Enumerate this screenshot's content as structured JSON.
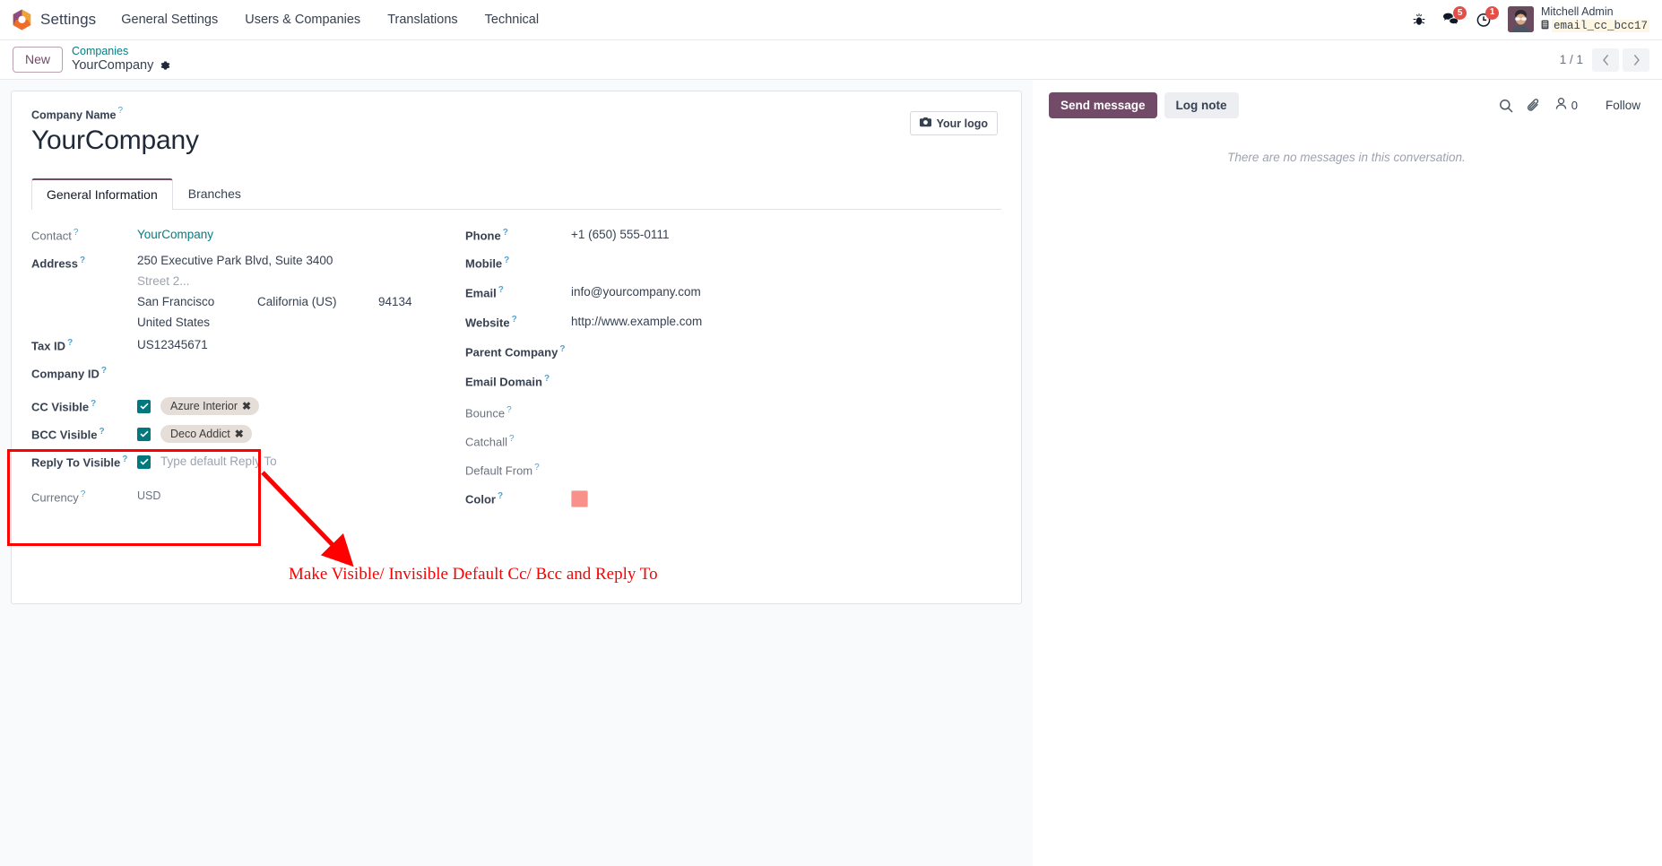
{
  "navbar": {
    "app_name": "Settings",
    "logo_icon": "odoo-hexagon-logo",
    "menu_items": [
      {
        "label": "General Settings"
      },
      {
        "label": "Users & Companies"
      },
      {
        "label": "Translations"
      },
      {
        "label": "Technical"
      }
    ],
    "icons": {
      "bug": "bug-icon",
      "messages": "messages-icon",
      "messages_badge": "5",
      "activities": "clock-activities-icon",
      "activities_badge": "1"
    },
    "user": {
      "name": "Mitchell Admin",
      "database": "email_cc_bcc17",
      "db_icon": "database-icon",
      "avatar": "user-avatar"
    }
  },
  "controlpanel": {
    "new_label": "New",
    "breadcrumb_parent": "Companies",
    "breadcrumb_current": "YourCompany",
    "gear_icon": "gear-icon",
    "pager_text": "1 / 1",
    "prev_icon": "chevron-left-icon",
    "next_icon": "chevron-right-icon"
  },
  "form": {
    "company_name_label": "Company Name",
    "company_name_value": "YourCompany",
    "logo_button_label": "Your logo",
    "logo_button_icon": "camera-icon",
    "tabs": [
      {
        "label": "General Information",
        "active": true
      },
      {
        "label": "Branches",
        "active": false
      }
    ],
    "left_fields": {
      "contact_label": "Contact",
      "contact_value": "YourCompany",
      "address_label": "Address",
      "address_street": "250 Executive Park Blvd, Suite 3400",
      "address_street2_placeholder": "Street 2...",
      "address_city": "San Francisco",
      "address_state": "California (US)",
      "address_zip": "94134",
      "address_country": "United States",
      "tax_id_label": "Tax ID",
      "tax_id_value": "US12345671",
      "company_id_label": "Company ID",
      "company_id_value": "",
      "cc_visible_label": "CC Visible",
      "cc_tag": "Azure Interior",
      "bcc_visible_label": "BCC Visible",
      "bcc_tag": "Deco Addict",
      "reply_to_visible_label": "Reply To Visible",
      "reply_to_placeholder": "Type default Reply To",
      "currency_label": "Currency",
      "currency_value": "USD",
      "tag_remove_icon": "close-x-icon"
    },
    "right_fields": {
      "phone_label": "Phone",
      "phone_value": "+1 (650) 555-0111",
      "mobile_label": "Mobile",
      "mobile_value": "",
      "email_label": "Email",
      "email_value": "info@yourcompany.com",
      "website_label": "Website",
      "website_value": "http://www.example.com",
      "parent_company_label": "Parent Company",
      "parent_company_value": "",
      "email_domain_label": "Email Domain",
      "email_domain_value": "",
      "bounce_label": "Bounce",
      "bounce_value": "",
      "catchall_label": "Catchall",
      "catchall_value": "",
      "default_from_label": "Default From",
      "default_from_value": "",
      "color_label": "Color",
      "color_value": "#f79189"
    }
  },
  "annotation": {
    "text": "Make Visible/ Invisible Default Cc/ Bcc and Reply To",
    "color": "#fe0000"
  },
  "chatter": {
    "send_message_label": "Send message",
    "log_note_label": "Log note",
    "search_icon": "search-icon",
    "attachment_icon": "paperclip-icon",
    "followers_icon": "user-followers-icon",
    "followers_count": "0",
    "follow_label": "Follow",
    "empty_text": "There are no messages in this conversation."
  },
  "colors": {
    "brand_purple": "#714b67",
    "teal_link": "#017e84",
    "checkbox_teal": "#00787d",
    "annotation_red": "#fe0000",
    "tag_bg": "#e5ddd8"
  }
}
